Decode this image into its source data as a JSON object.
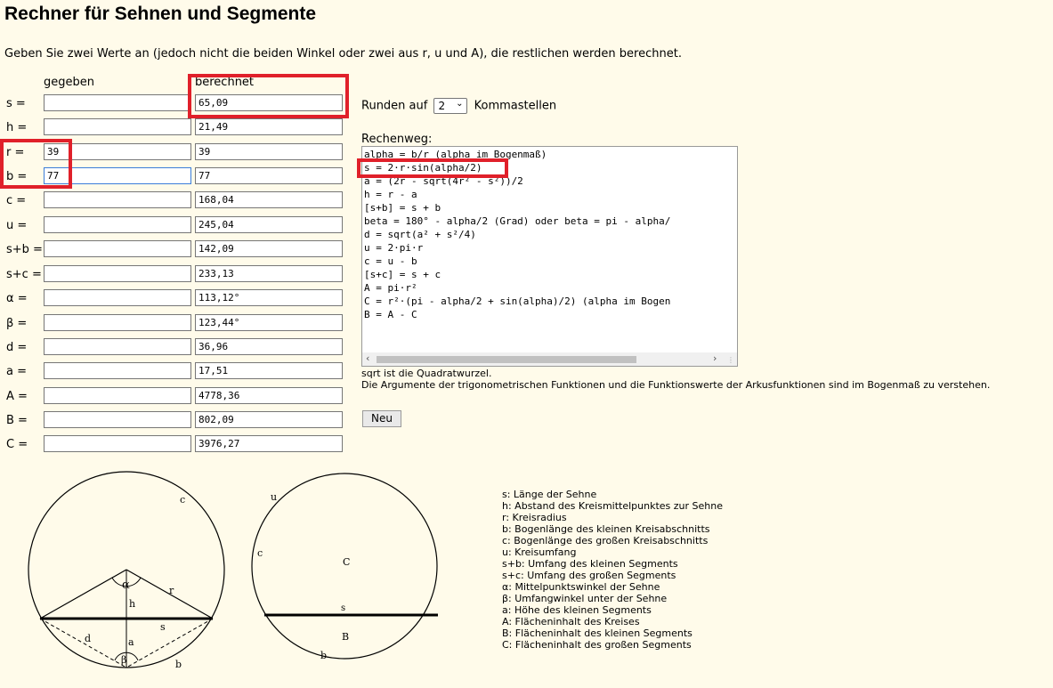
{
  "title": "Rechner für Sehnen und Segmente",
  "intro": "Geben Sie zwei Werte an (jedoch nicht die beiden Winkel oder zwei aus r, u und A), die restlichen werden berechnet.",
  "columns": {
    "given": "gegeben",
    "computed": "berechnet"
  },
  "rows": [
    {
      "label": "s =",
      "given": "",
      "computed": "65,09"
    },
    {
      "label": "h =",
      "given": "",
      "computed": "21,49"
    },
    {
      "label": "r =",
      "given": "39",
      "computed": "39"
    },
    {
      "label": "b =",
      "given": "77",
      "computed": "77"
    },
    {
      "label": "c =",
      "given": "",
      "computed": "168,04"
    },
    {
      "label": "u =",
      "given": "",
      "computed": "245,04"
    },
    {
      "label": "s+b =",
      "given": "",
      "computed": "142,09"
    },
    {
      "label": "s+c =",
      "given": "",
      "computed": "233,13"
    },
    {
      "label": "α =",
      "given": "",
      "computed": "113,12°"
    },
    {
      "label": "β =",
      "given": "",
      "computed": "123,44°"
    },
    {
      "label": "d =",
      "given": "",
      "computed": "36,96"
    },
    {
      "label": "a =",
      "given": "",
      "computed": "17,51"
    },
    {
      "label": "A =",
      "given": "",
      "computed": "4778,36"
    },
    {
      "label": "B =",
      "given": "",
      "computed": "802,09"
    },
    {
      "label": "C =",
      "given": "",
      "computed": "3976,27"
    }
  ],
  "rounding": {
    "prefix": "Runden auf",
    "value": "2",
    "suffix": "Kommastellen"
  },
  "rechenweg": {
    "label": "Rechenweg:",
    "lines": [
      "alpha = b/r (alpha im Bogenmaß)",
      "s = 2·r·sin(alpha/2)",
      "a = (2r - sqrt(4r² - s²))/2",
      "h = r - a",
      "[s+b] = s + b",
      "beta = 180° - alpha/2 (Grad) oder beta = pi - alpha/",
      "d = sqrt(a² + s²/4)",
      "u = 2·pi·r",
      "c = u - b",
      "[s+c] = s + c",
      "A = pi·r²",
      "C = r²·(pi - alpha/2 + sin(alpha)/2) (alpha im Bogen",
      "B = A - C"
    ]
  },
  "notes": [
    "sqrt ist die Quadratwurzel.",
    "Die Argumente der trigonometrischen Funktionen und die Funktionswerte der Arkusfunktionen sind im Bogenmaß zu verstehen."
  ],
  "new_button": "Neu",
  "diagram1": {
    "c": "c",
    "alpha": "α",
    "r": "r",
    "h": "h",
    "d": "d",
    "s": "s",
    "a": "a",
    "beta": "β",
    "b": "b"
  },
  "diagram2": {
    "u": "u",
    "c": "c",
    "C": "C",
    "s": "s",
    "B": "B",
    "b": "b"
  },
  "legend": [
    "s: Länge der Sehne",
    "h: Abstand des Kreismittelpunktes zur Sehne",
    "r: Kreisradius",
    "b: Bogenlänge des kleinen Kreisabschnitts",
    "c: Bogenlänge des großen Kreisabschnitts",
    "u: Kreisumfang",
    "s+b: Umfang des kleinen Segments",
    "s+c: Umfang des großen Segments",
    "α: Mittelpunktswinkel der Sehne",
    "β: Umfangwinkel unter der Sehne",
    "a: Höhe des kleinen Segments",
    "A: Flächeninhalt des Kreises",
    "B: Flächeninhalt des kleinen Segments",
    "C: Flächeninhalt des großen Segments"
  ]
}
